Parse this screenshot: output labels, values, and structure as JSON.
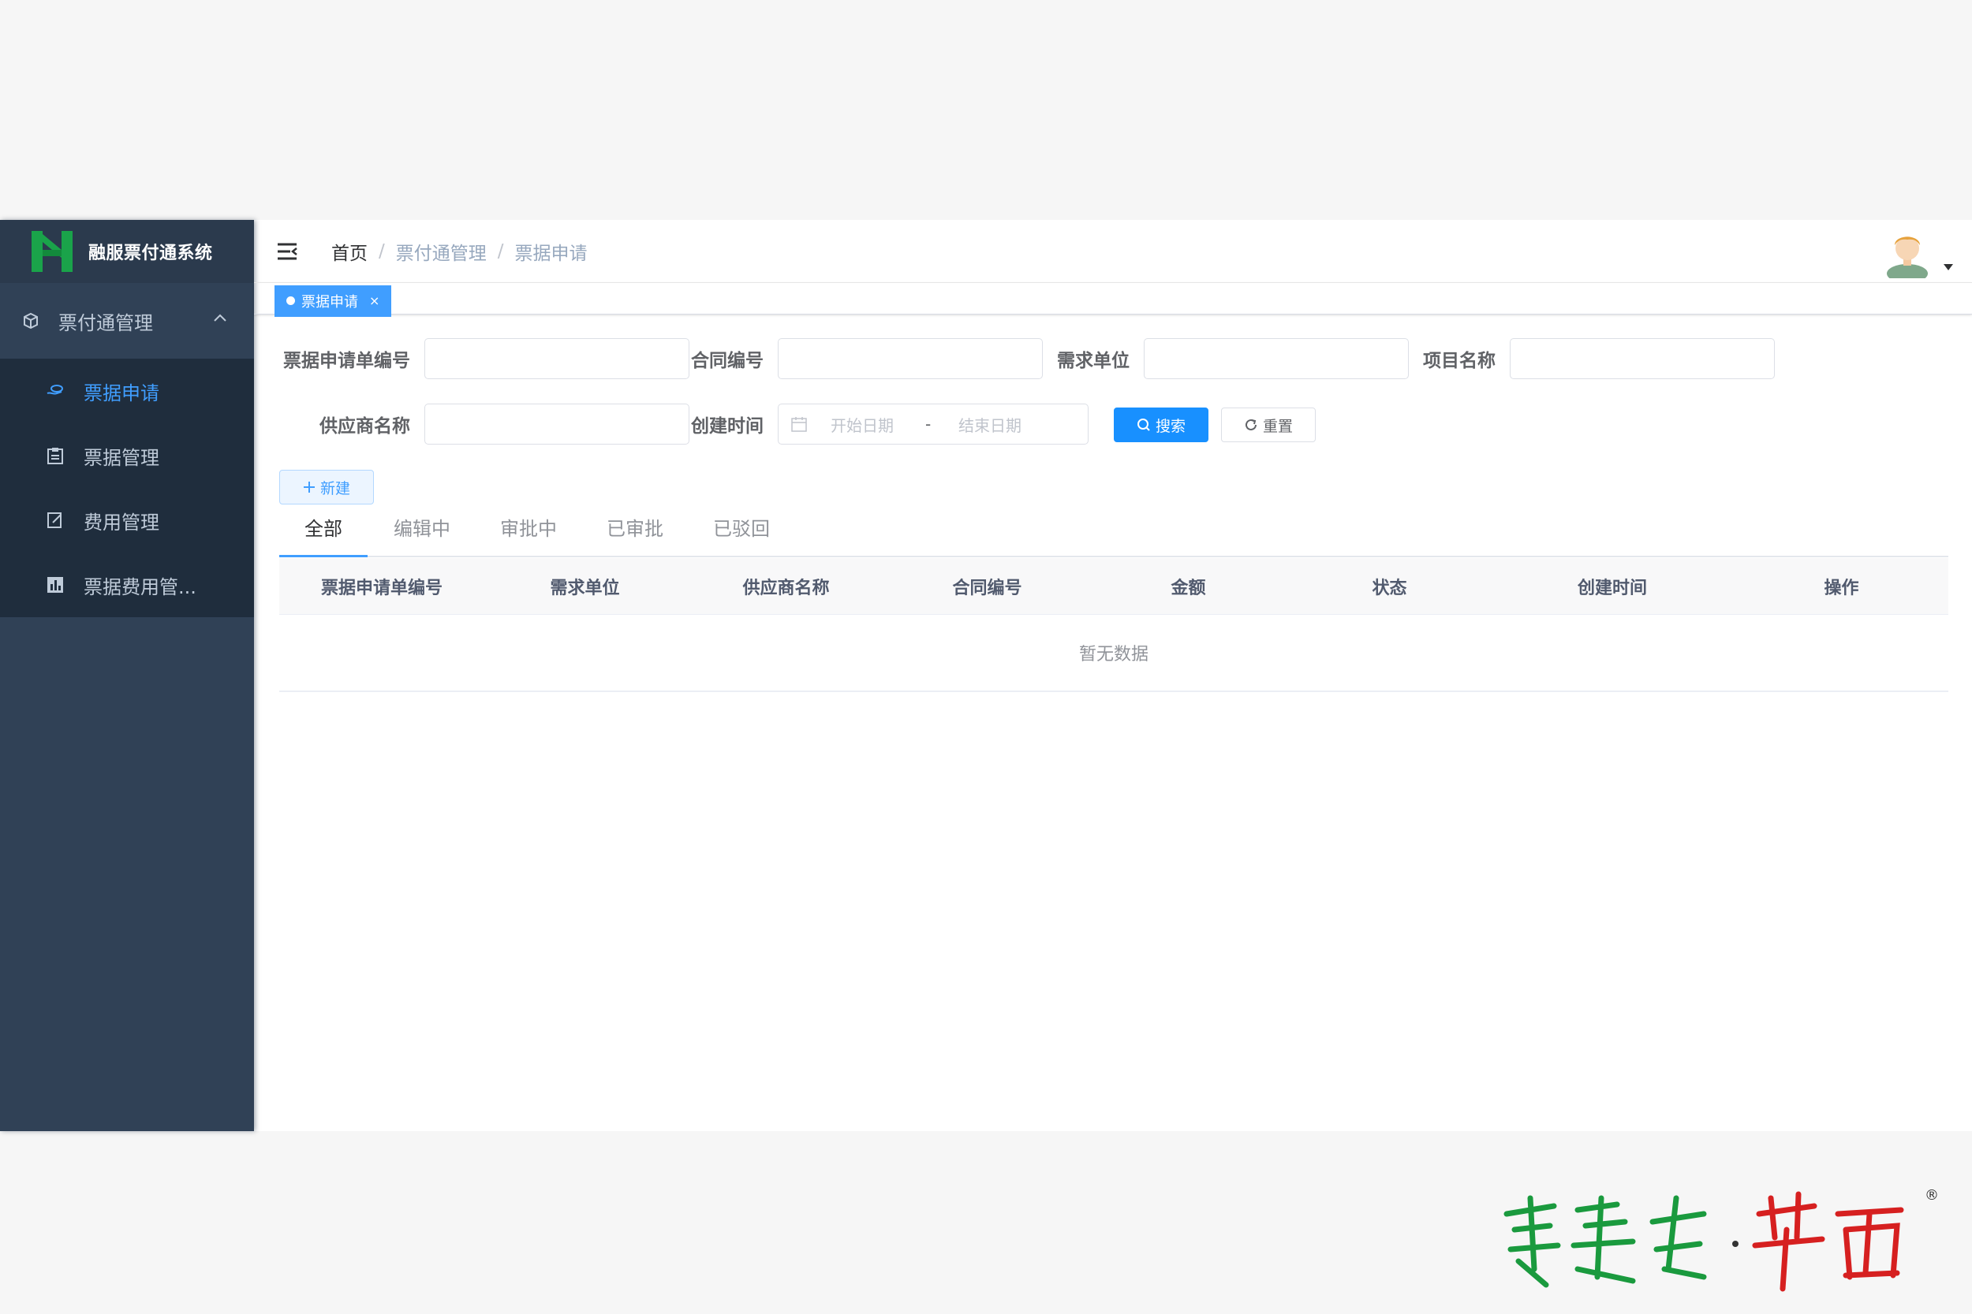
{
  "app": {
    "title": "融服票付通系统"
  },
  "sidebar": {
    "group": {
      "label": "票付通管理"
    },
    "items": [
      {
        "label": "票据申请",
        "active": true
      },
      {
        "label": "票据管理",
        "active": false
      },
      {
        "label": "费用管理",
        "active": false
      },
      {
        "label": "票据费用管..."
      }
    ]
  },
  "breadcrumb": [
    "首页",
    "票付通管理",
    "票据申请"
  ],
  "tags": [
    {
      "label": "票据申请",
      "close": "×"
    }
  ],
  "search_form": {
    "fields": [
      {
        "label": "票据申请单编号",
        "value": ""
      },
      {
        "label": "合同编号",
        "value": ""
      },
      {
        "label": "需求单位",
        "value": ""
      },
      {
        "label": "项目名称",
        "value": ""
      },
      {
        "label": "供应商名称",
        "value": ""
      },
      {
        "label": "创建时间"
      }
    ],
    "date_range": {
      "start_placeholder": "开始日期",
      "separator": "-",
      "end_placeholder": "结束日期"
    },
    "search_label": "搜索",
    "reset_label": "重置"
  },
  "toolbar": {
    "add_label": "新建"
  },
  "status_tabs": [
    "全部",
    "编辑中",
    "审批中",
    "已审批",
    "已驳回"
  ],
  "table": {
    "columns": [
      "票据申请单编号",
      "需求单位",
      "供应商名称",
      "合同编号",
      "金额",
      "状态",
      "创建时间",
      "操作"
    ],
    "empty_text": "暂无数据"
  },
  "colors": {
    "sidebar_bg": "#304156",
    "accent": "#409eff",
    "primary_button": "#1890ff"
  }
}
